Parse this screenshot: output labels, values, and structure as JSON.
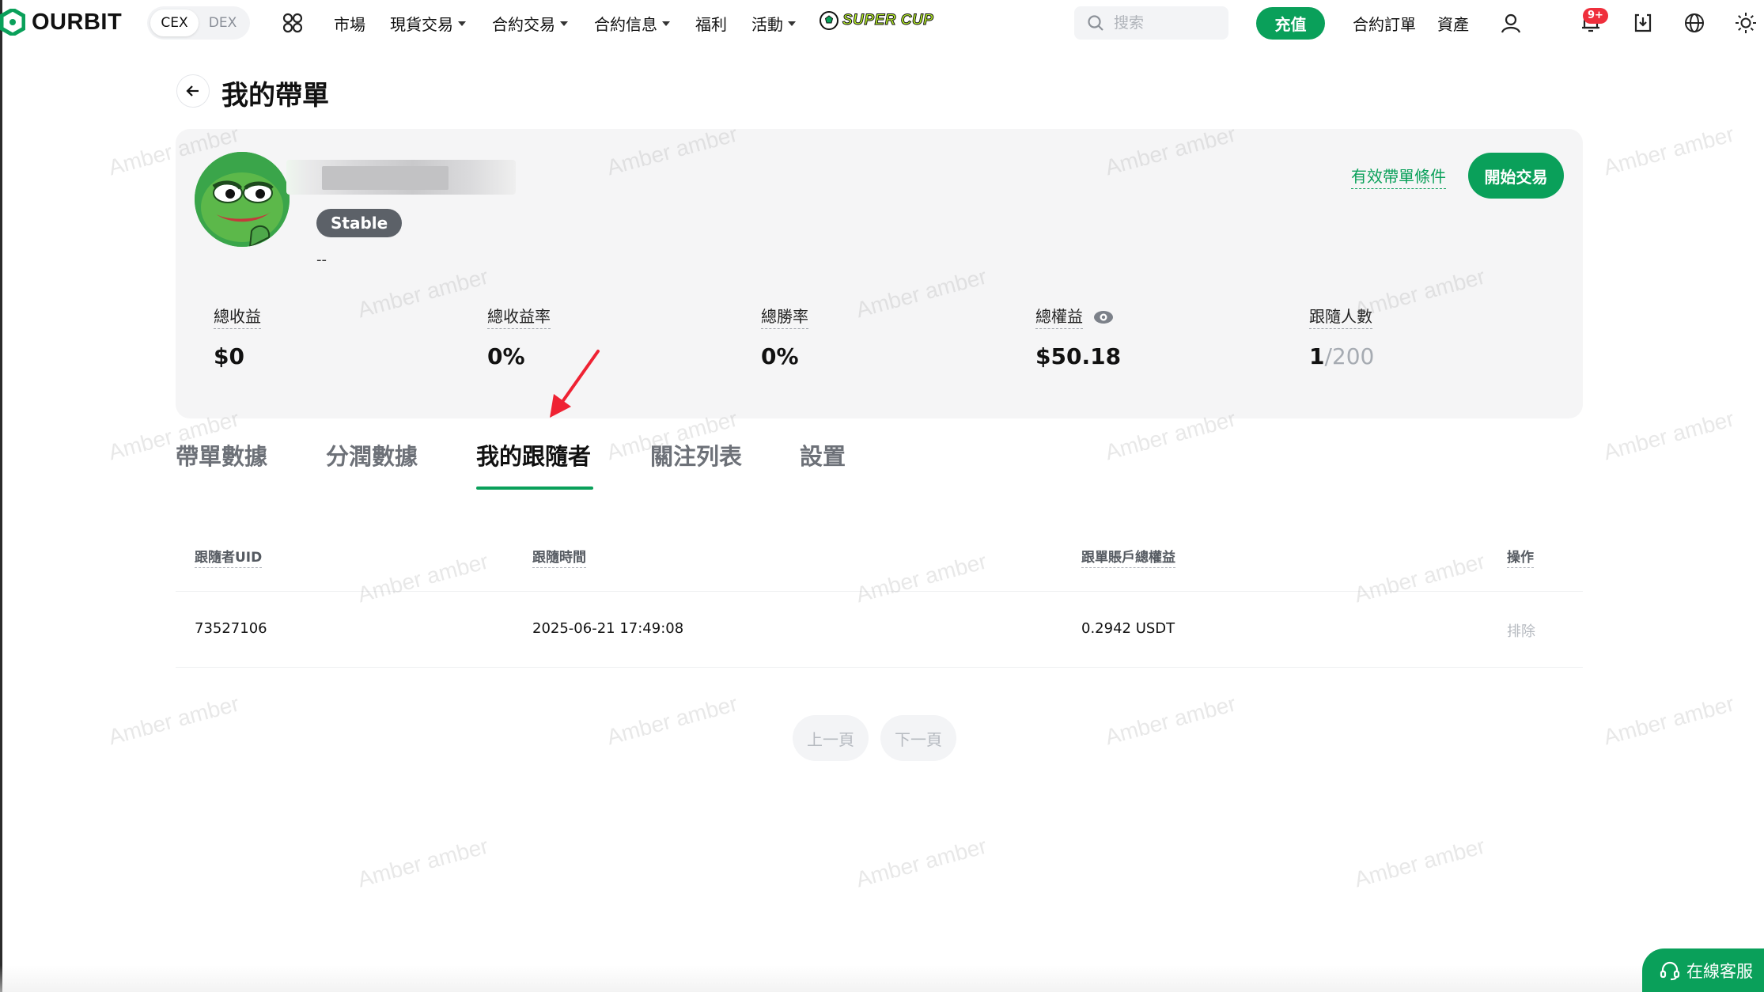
{
  "nav": {
    "logo_text": "OURBIT",
    "switch": {
      "cex": "CEX",
      "dex": "DEX"
    },
    "items": [
      {
        "label": "市場",
        "has_caret": false
      },
      {
        "label": "現貨交易",
        "has_caret": true
      },
      {
        "label": "合約交易",
        "has_caret": true
      },
      {
        "label": "合約信息",
        "has_caret": true
      },
      {
        "label": "福利",
        "has_caret": false
      },
      {
        "label": "活動",
        "has_caret": true
      }
    ],
    "supercup_label": "SUPER CUP",
    "search_placeholder": "搜索",
    "deposit_label": "充值",
    "contract_orders": "合約訂單",
    "assets": "資產",
    "notification_badge": "9+",
    "accent_color": "#0aa05a"
  },
  "page": {
    "title": "我的帶單"
  },
  "profile": {
    "tag": "Stable",
    "bio": "--",
    "conditions_link": "有效帶單條件",
    "start_trading": "開始交易"
  },
  "stats": [
    {
      "label": "總收益",
      "value": "$0",
      "sub": ""
    },
    {
      "label": "總收益率",
      "value": "0%",
      "sub": ""
    },
    {
      "label": "總勝率",
      "value": "0%",
      "sub": ""
    },
    {
      "label": "總權益",
      "value": "$50.18",
      "sub": ""
    },
    {
      "label": "跟隨人數",
      "value": "1",
      "sub": "/200"
    }
  ],
  "tabs": [
    {
      "label": "帶單數據",
      "active": false
    },
    {
      "label": "分潤數據",
      "active": false
    },
    {
      "label": "我的跟隨者",
      "active": true
    },
    {
      "label": "關注列表",
      "active": false
    },
    {
      "label": "設置",
      "active": false
    }
  ],
  "table": {
    "headers": [
      "跟隨者UID",
      "跟隨時間",
      "跟單賬戶總權益",
      "操作"
    ],
    "rows": [
      {
        "uid": "73527106",
        "time": "2025-06-21 17:49:08",
        "equity": "0.2942 USDT",
        "action": "排除"
      }
    ]
  },
  "pagination": {
    "prev": "上一頁",
    "next": "下一頁"
  },
  "support_label": "在線客服",
  "watermark_text": "Amber amber"
}
